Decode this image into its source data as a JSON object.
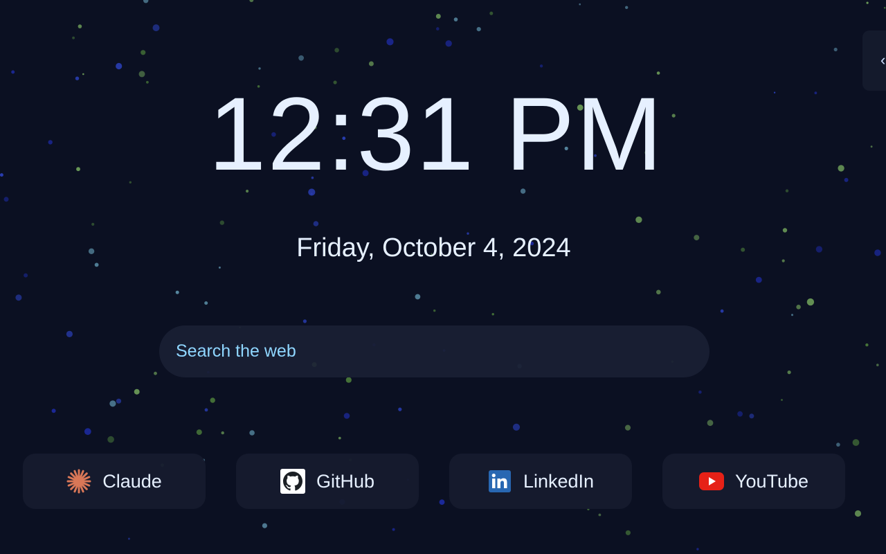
{
  "clock": {
    "time": "12:31 PM"
  },
  "date": {
    "text": "Friday, October 4, 2024"
  },
  "search": {
    "placeholder": "Search the web"
  },
  "shortcuts": [
    {
      "label": "Claude",
      "icon": "claude-icon"
    },
    {
      "label": "GitHub",
      "icon": "github-icon"
    },
    {
      "label": "LinkedIn",
      "icon": "linkedin-icon"
    },
    {
      "label": "YouTube",
      "icon": "youtube-icon"
    }
  ],
  "colors": {
    "background": "#0b1022",
    "text": "#e6f0ff",
    "search_text": "#8fd6ff",
    "card": "#161b2e",
    "claude": "#d97757",
    "linkedin": "#2867b2",
    "youtube": "#e62117"
  }
}
